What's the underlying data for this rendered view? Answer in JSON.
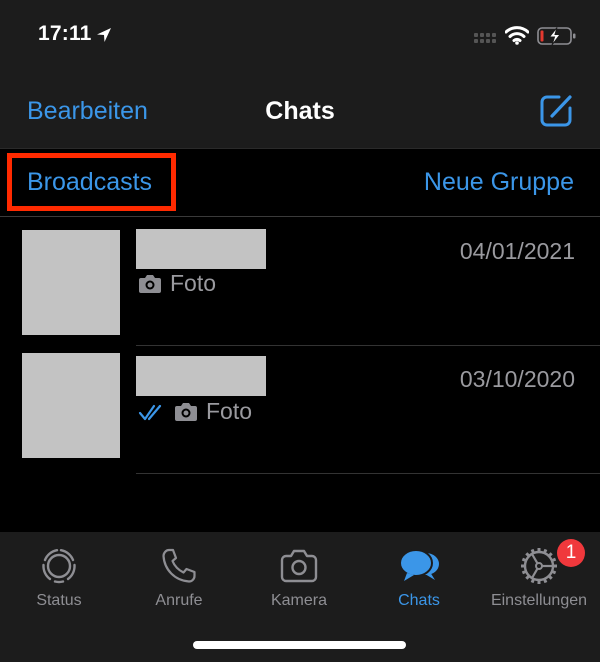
{
  "status_bar": {
    "time": "17:11",
    "icons": [
      "location-arrow-icon",
      "cellular-signal-icon",
      "wifi-icon",
      "battery-charging-icon"
    ],
    "battery_level": 0.1,
    "battery_low_color": "#e5392f"
  },
  "nav": {
    "edit_label": "Bearbeiten",
    "title": "Chats",
    "compose_icon": "compose-icon"
  },
  "actions": {
    "broadcasts_label": "Broadcasts",
    "new_group_label": "Neue Gruppe",
    "highlight_color": "#ff2a00"
  },
  "chats": [
    {
      "name": "",
      "date": "04/01/2021",
      "preview": "Foto",
      "preview_icon": "camera-icon",
      "read_receipt": false
    },
    {
      "name": "",
      "date": "03/10/2020",
      "preview": "Foto",
      "preview_icon": "camera-icon",
      "read_receipt": true
    }
  ],
  "tabbar": {
    "tabs": [
      {
        "label": "Status",
        "icon": "status-icon",
        "active": false
      },
      {
        "label": "Anrufe",
        "icon": "phone-icon",
        "active": false
      },
      {
        "label": "Kamera",
        "icon": "camera-icon",
        "active": false
      },
      {
        "label": "Chats",
        "icon": "chat-bubbles-icon",
        "active": true
      },
      {
        "label": "Einstellungen",
        "icon": "gear-icon",
        "active": false,
        "badge": "1"
      }
    ]
  },
  "colors": {
    "accent": "#3b96e8",
    "badge": "#f0383c",
    "secondary_text": "#9a9a9f",
    "bar_background": "#1c1c1c"
  }
}
